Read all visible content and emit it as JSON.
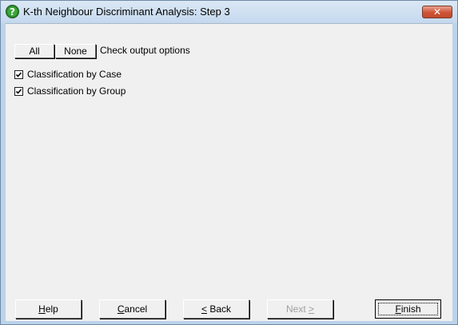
{
  "window": {
    "title": "K-th Neighbour Discriminant Analysis: Step 3",
    "close_glyph": "✕",
    "icon": "help-question-icon",
    "accent_close": "#c14a2e",
    "title_bar_color": "#c4d8ee"
  },
  "options": {
    "all_label": "All",
    "none_label": "None",
    "header": "Check output options",
    "items": [
      {
        "label": "Classification by Case",
        "checked": true
      },
      {
        "label": "Classification by Group",
        "checked": true
      }
    ]
  },
  "buttons": {
    "help": {
      "accel": "H",
      "rest": "elp"
    },
    "cancel": {
      "accel": "C",
      "rest": "ancel"
    },
    "back": {
      "accel": "<",
      "rest": " Back"
    },
    "next": {
      "pre": "Next ",
      "accel": ">",
      "enabled": false
    },
    "finish": {
      "accel": "F",
      "rest": "inish"
    }
  }
}
